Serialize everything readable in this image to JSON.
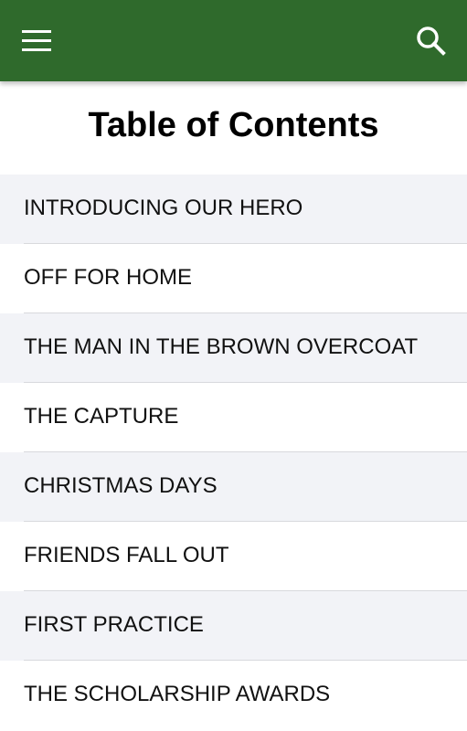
{
  "header": {
    "menu_icon": "hamburger-menu-icon",
    "search_icon": "search-icon",
    "background_color": "#2f6a2c"
  },
  "page": {
    "title": "Table of Contents"
  },
  "toc": {
    "items": [
      {
        "label": "INTRODUCING OUR HERO"
      },
      {
        "label": "OFF FOR HOME"
      },
      {
        "label": "THE MAN IN THE BROWN OVERCOAT"
      },
      {
        "label": "THE CAPTURE"
      },
      {
        "label": "CHRISTMAS DAYS"
      },
      {
        "label": "FRIENDS FALL OUT"
      },
      {
        "label": "FIRST PRACTICE"
      },
      {
        "label": "THE SCHOLARSHIP AWARDS"
      }
    ]
  }
}
